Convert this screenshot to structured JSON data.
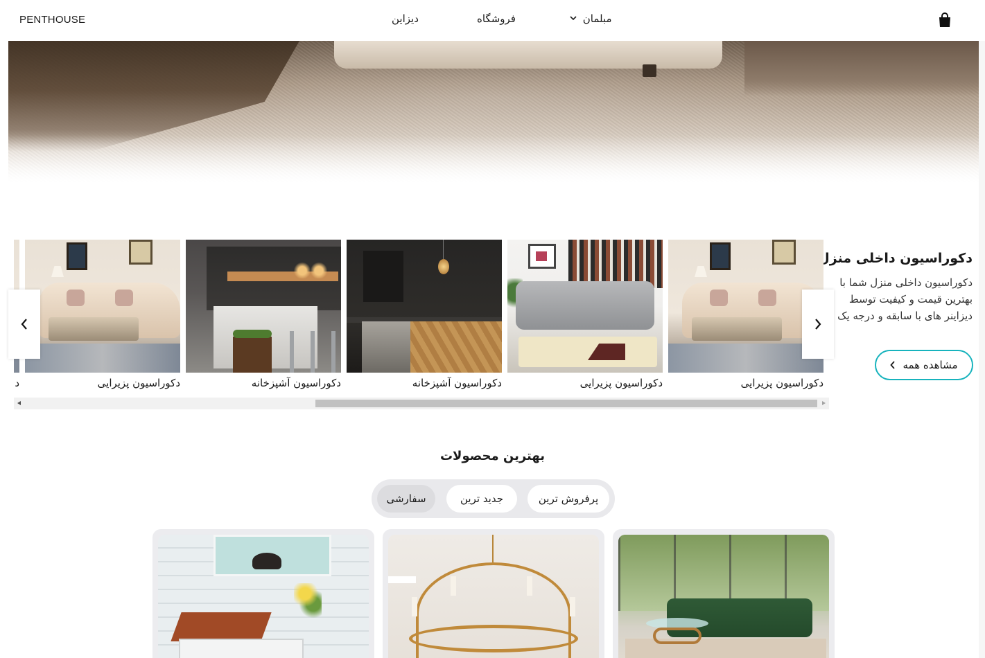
{
  "navbar": {
    "brand": "PENTHOUSE",
    "links": [
      {
        "label": "دیزاین"
      },
      {
        "label": "فروشگاه"
      },
      {
        "label": "مبلمان",
        "has_dropdown": true
      }
    ],
    "cart_icon": "shopping-bag-icon"
  },
  "interior": {
    "title": "دکوراسیون داخلی منزل",
    "description": "دکوراسیون داخلی منزل شما با بهترین قیمت و کیفیت توسط دیزاینر های با سابقه و درجه یک",
    "view_all_label": "مشاهده همه",
    "slides": [
      {
        "caption": "دکوراسیون پزیرایی",
        "image": "living-room"
      },
      {
        "caption": "دکوراسیون پزیرایی",
        "image": "grey-sofa-room"
      },
      {
        "caption": "دکوراسیون آشپزخانه",
        "image": "dark-kitchen"
      },
      {
        "caption": "دکوراسیون آشپزخانه",
        "image": "island-kitchen"
      },
      {
        "caption": "دکوراسیون پزیرایی",
        "image": "living-room"
      },
      {
        "caption": "د",
        "image": "living-room"
      }
    ]
  },
  "products": {
    "title": "بهترین محصولات",
    "tabs": [
      {
        "label": "پرفروش ترین",
        "active": false
      },
      {
        "label": "جدید ترین",
        "active": false
      },
      {
        "label": "سفارشی",
        "active": true
      }
    ],
    "cards": [
      {
        "image": "desk"
      },
      {
        "image": "chandelier"
      },
      {
        "image": "green-sofa"
      }
    ]
  },
  "colors": {
    "accent": "#17b3bd",
    "tab_bg": "#e9e9ec",
    "active_tab": "#dcdcdf"
  }
}
